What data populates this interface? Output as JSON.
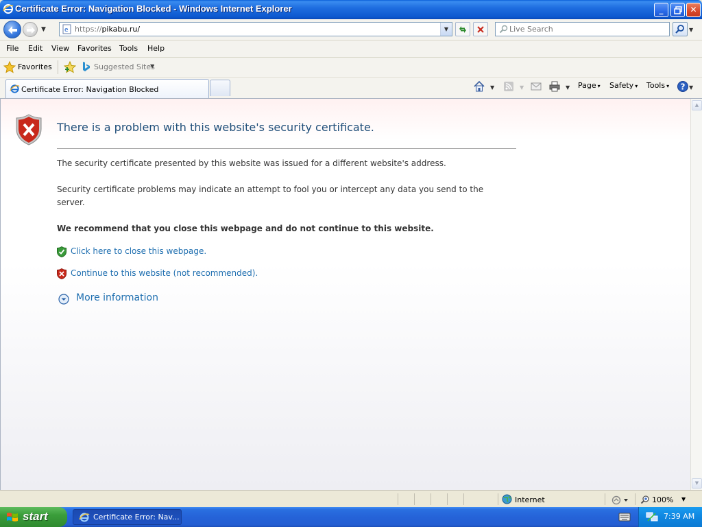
{
  "window": {
    "title": "Certificate Error: Navigation Blocked - Windows Internet Explorer",
    "minimize_label": "_",
    "maximize_label": "▫",
    "close_label": "✕"
  },
  "address_bar": {
    "scheme": "https://",
    "host": "pikabu.ru/",
    "dropdown_glyph": "▼"
  },
  "search": {
    "placeholder": "Live Search"
  },
  "menu": {
    "items": [
      "File",
      "Edit",
      "View",
      "Favorites",
      "Tools",
      "Help"
    ]
  },
  "favorites_bar": {
    "favorites_label": "Favorites",
    "suggested_label": "Suggested Sites"
  },
  "tab": {
    "label": "Certificate Error: Navigation Blocked"
  },
  "command_bar": {
    "page_label": "Page",
    "safety_label": "Safety",
    "tools_label": "Tools",
    "dropdown_glyph": "▾"
  },
  "error_page": {
    "title": "There is a problem with this website's security certificate.",
    "paragraph1": "The security certificate presented by this website was issued for a different website's address.",
    "paragraph2": "Security certificate problems may indicate an attempt to fool you or intercept any data you send to the server.",
    "recommendation": "We recommend that you close this webpage and do not continue to this website.",
    "close_link": "Click here to close this webpage.",
    "continue_link": "Continue to this website (not recommended).",
    "more_info": "More information"
  },
  "status_bar": {
    "zone": "Internet",
    "zoom": "100%"
  },
  "taskbar": {
    "start_label": "start",
    "task_label": "Certificate Error: Nav...",
    "clock": "7:39 AM"
  },
  "colors": {
    "link": "#1f6fb0",
    "title_text": "#1f4e79",
    "error_red": "#c8281b",
    "safe_green": "#2d8a2d"
  },
  "icons": {
    "app": "ie-icon",
    "error_shield": "error-shield-icon",
    "safe_shield": "green-shield-icon",
    "unsafe_shield": "red-shield-icon",
    "more_info": "expand-circle-icon"
  }
}
